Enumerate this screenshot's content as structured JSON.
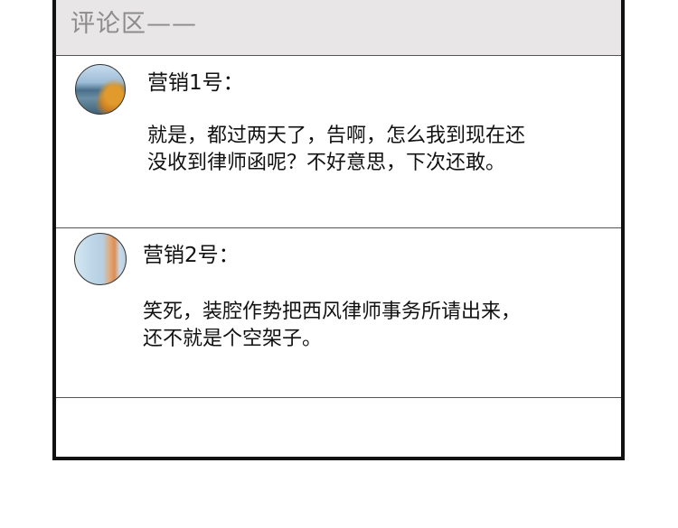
{
  "header": {
    "title": "评论区——"
  },
  "comments": [
    {
      "username": "营销1号：",
      "lines": [
        "就是，都过两天了，告啊，怎么我到现在还",
        "没收到律师函呢？不好意思，下次还敢。"
      ]
    },
    {
      "username": "营销2号：",
      "lines": [
        "笑死，装腔作势把西风律师事务所请出来，",
        "还不就是个空架子。"
      ]
    }
  ]
}
